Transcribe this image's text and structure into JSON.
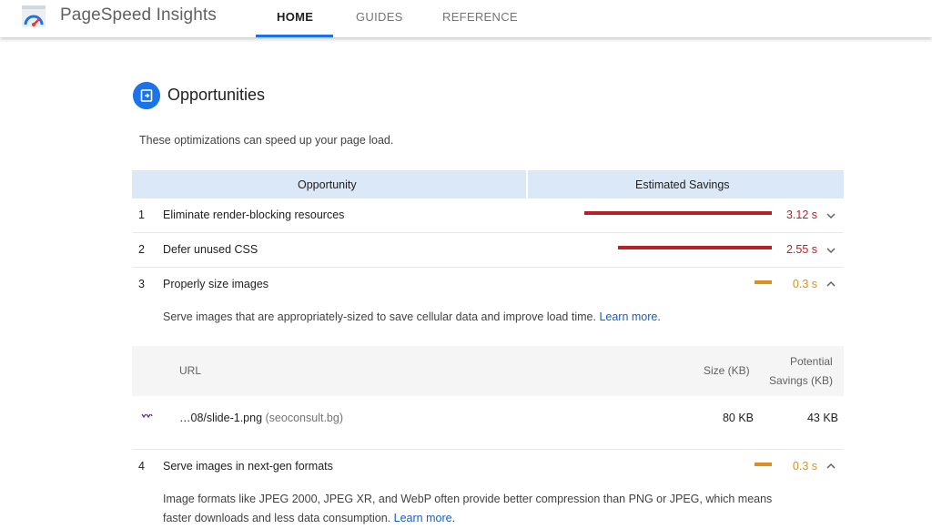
{
  "header": {
    "app_title": "PageSpeed Insights",
    "tabs": [
      {
        "label": "HOME",
        "active": true
      },
      {
        "label": "GUIDES",
        "active": false
      },
      {
        "label": "REFERENCE",
        "active": false
      }
    ],
    "accent_color": "#1a73e8"
  },
  "section": {
    "icon": "opportunity-icon",
    "title": "Opportunities",
    "description": "These optimizations can speed up your page load."
  },
  "table": {
    "columns": [
      "Opportunity",
      "Estimated Savings"
    ],
    "rows": [
      {
        "index": "1",
        "label": "Eliminate render-blocking resources",
        "savings": "3.12 s",
        "severity": "fail",
        "color": "#b52126",
        "expanded": false
      },
      {
        "index": "2",
        "label": "Defer unused CSS",
        "savings": "2.55 s",
        "severity": "fail",
        "color": "#b52126",
        "expanded": false
      },
      {
        "index": "3",
        "label": "Properly size images",
        "savings": "0.3 s",
        "severity": "average",
        "color": "#e08e1f",
        "expanded": true,
        "detail_text": "Serve images that are appropriately-sized to save cellular data and improve load time.",
        "detail_link": "Learn more",
        "detail_link_suffix": ".",
        "subtable": {
          "headers": {
            "url": "URL",
            "size": "Size (KB)",
            "potential_line1": "Potential",
            "potential_line2": "Savings (KB)"
          },
          "rows": [
            {
              "file": "…08/slide-1.png",
              "host": "(seoconsult.bg)",
              "size": "80 KB",
              "savings": "43 KB"
            }
          ]
        }
      },
      {
        "index": "4",
        "label": "Serve images in next-gen formats",
        "savings": "0.3 s",
        "severity": "average",
        "color": "#e08e1f",
        "expanded": true,
        "detail_line1": "Image formats like JPEG 2000, JPEG XR, and WebP often provide better compression than PNG or JPEG, which means",
        "detail_line2": "faster downloads and less data consumption.",
        "detail_link": "Learn more",
        "detail_link_suffix": "."
      }
    ]
  }
}
